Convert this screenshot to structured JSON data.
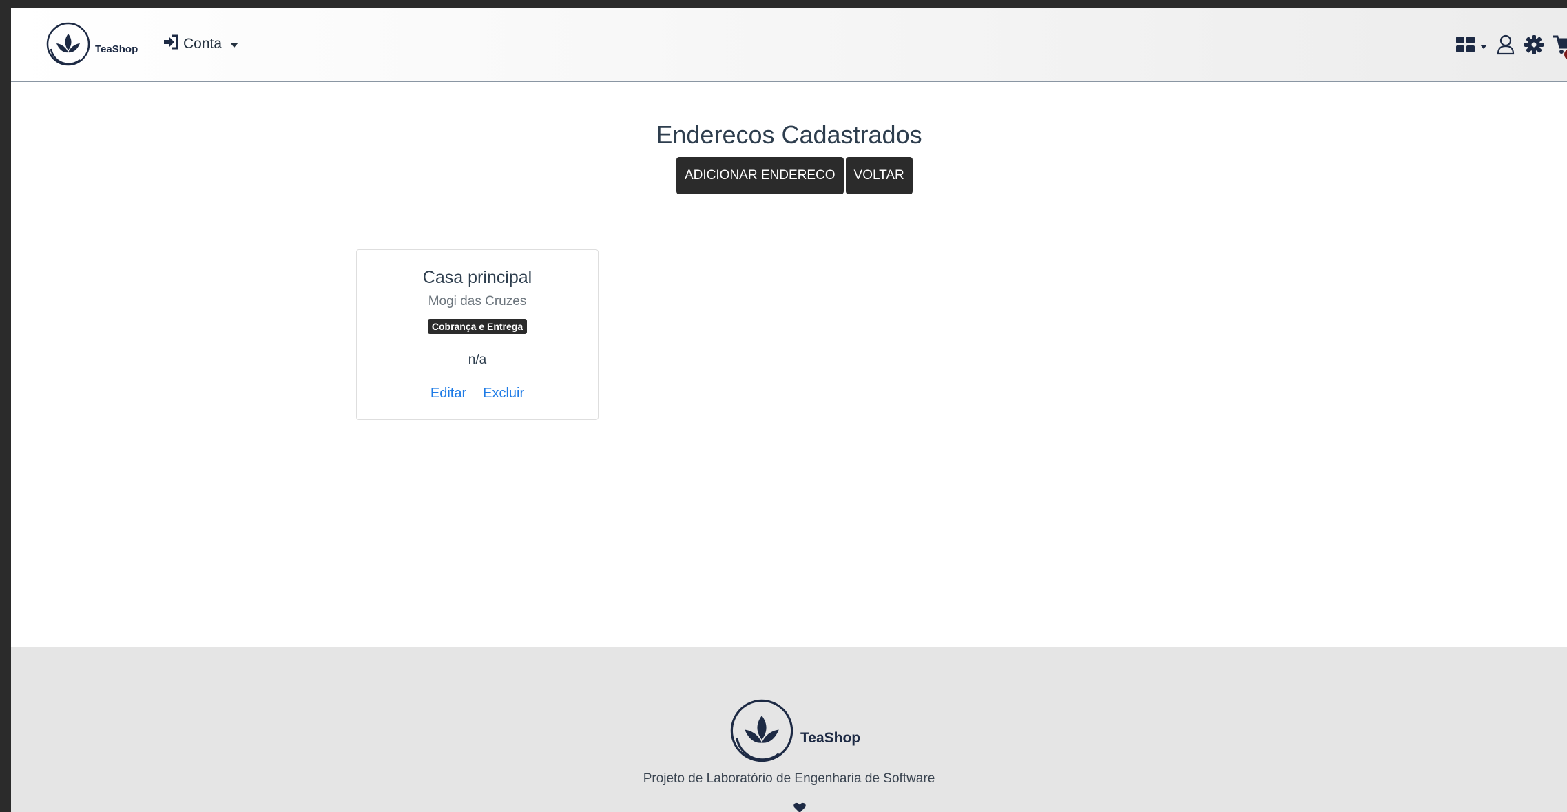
{
  "navbar": {
    "brand_name": "TeaShop",
    "account_label": "Conta",
    "cart_count": "0"
  },
  "main": {
    "title": "Enderecos Cadastrados",
    "add_button": "ADICIONAR ENDERECO",
    "back_button": "VOLTAR"
  },
  "addresses": [
    {
      "name": "Casa principal",
      "city": "Mogi das Cruzes",
      "type_badge": "Cobrança e Entrega",
      "note": "n/a",
      "edit_label": "Editar",
      "delete_label": "Excluir"
    }
  ],
  "footer": {
    "brand_name": "TeaShop",
    "caption": "Projeto de Laboratório de Engenharia de Software"
  },
  "colors": {
    "dark_button": "#2b2b2b",
    "link": "#1e7be6",
    "brand_navy": "#1d2a44",
    "badge_red": "#7a1a1a"
  },
  "icons": [
    "tea-leaf-logo-icon",
    "sign-in-icon",
    "grid-icon",
    "user-icon",
    "gear-icon",
    "cart-icon",
    "heart-icon"
  ]
}
